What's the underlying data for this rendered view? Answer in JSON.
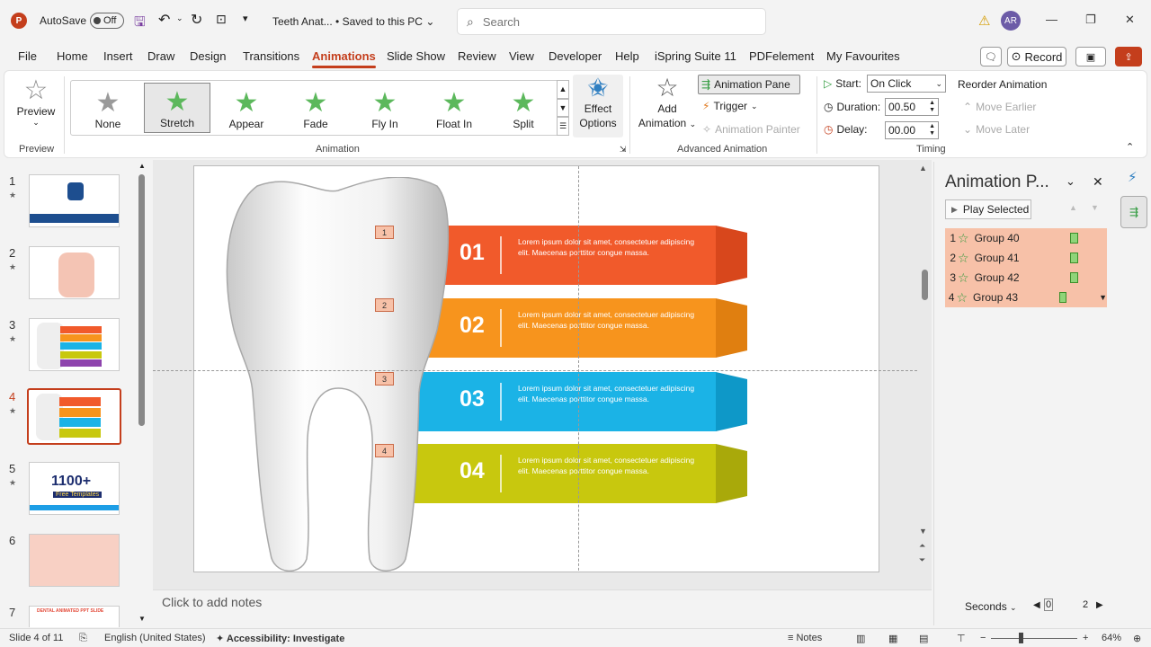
{
  "titlebar": {
    "autosave_label": "AutoSave",
    "autosave_state": "Off",
    "doc_title": "Teeth Anat...  •  Saved to this PC",
    "search_placeholder": "Search",
    "avatar_initials": "AR"
  },
  "tabs": [
    "File",
    "Home",
    "Insert",
    "Draw",
    "Design",
    "Transitions",
    "Animations",
    "Slide Show",
    "Review",
    "View",
    "Developer",
    "Help",
    "iSpring Suite 11",
    "PDFelement",
    "My Favourites"
  ],
  "active_tab": "Animations",
  "record_label": "Record",
  "ribbon": {
    "preview_label": "Preview",
    "preview_group": "Preview",
    "animation_group": "Animation",
    "animations": [
      {
        "label": "None",
        "color": "#9a9a9a"
      },
      {
        "label": "Stretch",
        "color": "#5cb85c"
      },
      {
        "label": "Appear",
        "color": "#5cb85c"
      },
      {
        "label": "Fade",
        "color": "#5cb85c"
      },
      {
        "label": "Fly In",
        "color": "#5cb85c"
      },
      {
        "label": "Float In",
        "color": "#5cb85c"
      },
      {
        "label": "Split",
        "color": "#5cb85c"
      }
    ],
    "effect_options_l1": "Effect",
    "effect_options_l2": "Options",
    "add_animation_l1": "Add",
    "add_animation_l2": "Animation",
    "animation_pane": "Animation Pane",
    "trigger": "Trigger",
    "animation_painter": "Animation Painter",
    "advanced_group": "Advanced Animation",
    "start_label": "Start:",
    "start_value": "On Click",
    "duration_label": "Duration:",
    "duration_value": "00.50",
    "delay_label": "Delay:",
    "delay_value": "00.00",
    "timing_group": "Timing",
    "reorder_label": "Reorder Animation",
    "move_earlier": "Move Earlier",
    "move_later": "Move Later"
  },
  "slides": [
    "1",
    "2",
    "3",
    "4",
    "5",
    "6",
    "7"
  ],
  "active_slide_index": 3,
  "thumb_text": {
    "s5_big": "1100+",
    "s5_sub": "Free Templates",
    "s7_title": "DENTAL ANIMATED PPT SLIDE"
  },
  "slide": {
    "banners": [
      {
        "num": "01",
        "text": "Lorem ipsum dolor sit amet, consectetuer adipiscing elit. Maecenas porttitor congue massa.",
        "color": "#f15a2b",
        "dark": "#d8471c"
      },
      {
        "num": "02",
        "text": "Lorem ipsum dolor sit amet, consectetuer adipiscing elit. Maecenas porttitor congue massa.",
        "color": "#f7941d",
        "dark": "#e07f10"
      },
      {
        "num": "03",
        "text": "Lorem ipsum dolor sit amet, consectetuer adipiscing elit. Maecenas porttitor congue massa.",
        "color": "#1bb3e6",
        "dark": "#0e98c8"
      },
      {
        "num": "04",
        "text": "Lorem ipsum dolor sit amet, consectetuer adipiscing elit. Maecenas porttitor congue massa.",
        "color": "#c8c80e",
        "dark": "#a9a90a"
      }
    ],
    "tags": [
      "1",
      "2",
      "3",
      "4"
    ]
  },
  "notes_placeholder": "Click to add notes",
  "anim_pane": {
    "title": "Animation P...",
    "play_selected": "Play Selected",
    "items": [
      {
        "idx": "1",
        "label": "Group 40"
      },
      {
        "idx": "2",
        "label": "Group 41"
      },
      {
        "idx": "3",
        "label": "Group 42"
      },
      {
        "idx": "4",
        "label": "Group 43"
      }
    ],
    "seconds_label": "Seconds",
    "timeline_start": "0",
    "timeline_end": "2"
  },
  "status": {
    "slide_info": "Slide 4 of 11",
    "language": "English (United States)",
    "accessibility": "Accessibility: Investigate",
    "notes": "Notes",
    "zoom": "64%"
  }
}
